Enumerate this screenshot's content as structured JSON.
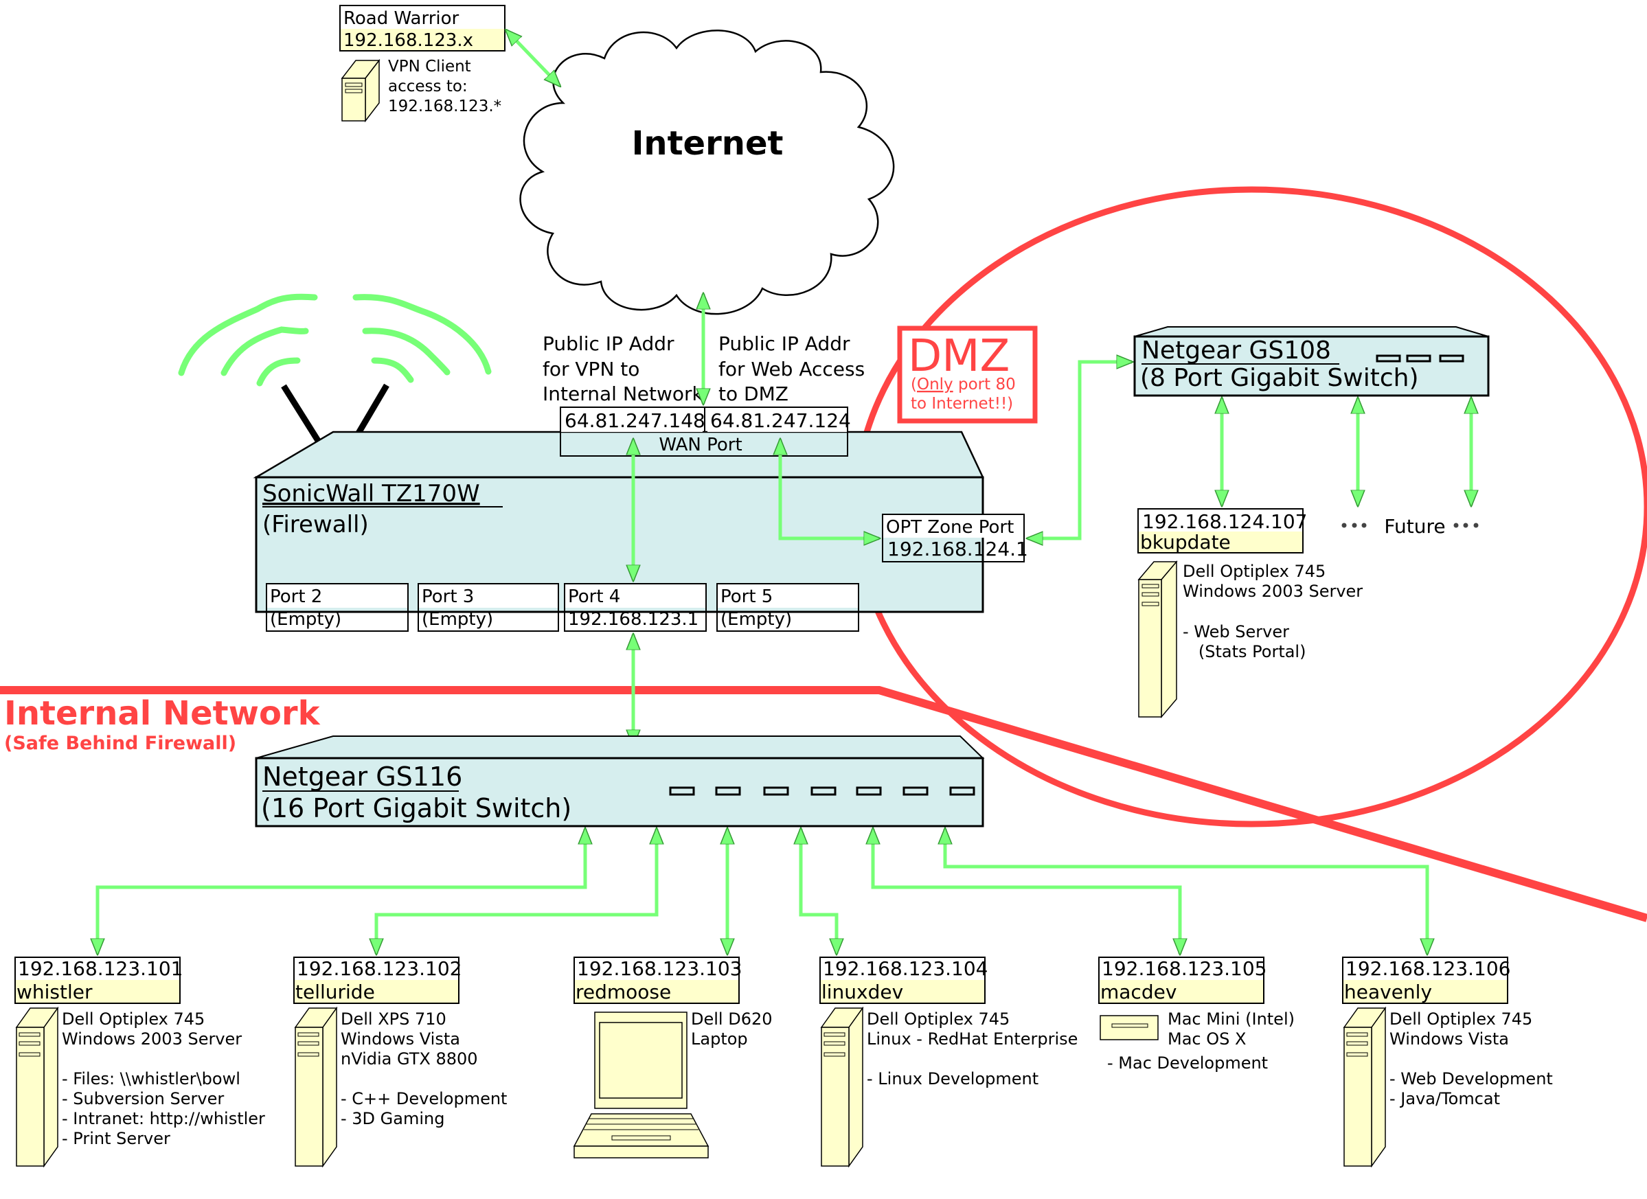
{
  "colors": {
    "device_fill": "#d6eeee",
    "label_yellow": "#ffffcc",
    "computer_fill": "#ffffcc",
    "link_green": "#77ff77",
    "zone_red": "#ff4444",
    "outline": "#000000"
  },
  "internet": {
    "label": "Internet"
  },
  "road_warrior": {
    "name": "Road Warrior",
    "ip": "192.168.123.x",
    "desc": [
      "VPN Client",
      "access to:",
      "192.168.123.*"
    ]
  },
  "wan": {
    "vpn_note": [
      "Public IP Addr",
      "for VPN to",
      "Internal Network"
    ],
    "dmz_note": [
      "Public IP Addr",
      "for Web Access",
      "to DMZ"
    ],
    "ip_vpn": "64.81.247.148",
    "ip_dmz": "64.81.247.124",
    "port_label": "WAN Port"
  },
  "firewall": {
    "name": "SonicWall TZ170W",
    "role": "(Firewall)",
    "ports": [
      {
        "name": "Port 2",
        "value": "(Empty)"
      },
      {
        "name": "Port 3",
        "value": "(Empty)"
      },
      {
        "name": "Port 4",
        "value": "192.168.123.1"
      },
      {
        "name": "Port 5",
        "value": "(Empty)"
      }
    ],
    "opt_port": {
      "name": "OPT Zone Port",
      "ip": "192.168.124.1"
    }
  },
  "dmz": {
    "title": "DMZ",
    "note_prefix": "(",
    "note_emph": "Only",
    "note_rest": " port 80",
    "note_line2": "to Internet!!)",
    "switch": {
      "name": "Netgear GS108",
      "desc": "(8 Port Gigabit Switch)"
    },
    "future_label": "Future",
    "host": {
      "ip": "192.168.124.107",
      "name": "bkupdate",
      "desc": [
        "Dell Optiplex 745",
        "Windows 2003 Server",
        "",
        "- Web Server",
        "   (Stats Portal)"
      ]
    }
  },
  "internal": {
    "title": "Internal Network",
    "subtitle": "(Safe Behind Firewall)",
    "switch": {
      "name": "Netgear GS116",
      "desc": "(16 Port Gigabit Switch)"
    },
    "hosts": [
      {
        "ip": "192.168.123.101",
        "name": "whistler",
        "type": "tower",
        "desc": [
          "Dell Optiplex 745",
          "Windows 2003 Server",
          "",
          "- Files: \\\\whistler\\bowl",
          "- Subversion Server",
          "- Intranet: http://whistler",
          "- Print Server"
        ]
      },
      {
        "ip": "192.168.123.102",
        "name": "telluride",
        "type": "tower",
        "desc": [
          "Dell XPS 710",
          "Windows Vista",
          "nVidia GTX 8800",
          "",
          "- C++ Development",
          "- 3D Gaming"
        ]
      },
      {
        "ip": "192.168.123.103",
        "name": "redmoose",
        "type": "laptop",
        "desc": [
          "Dell D620",
          "Laptop"
        ]
      },
      {
        "ip": "192.168.123.104",
        "name": "linuxdev",
        "type": "tower",
        "desc": [
          "Dell Optiplex 745",
          "Linux - RedHat Enterprise",
          "",
          "- Linux Development"
        ]
      },
      {
        "ip": "192.168.123.105",
        "name": "macdev",
        "type": "mini",
        "desc": [
          "Mac Mini (Intel)",
          "Mac OS X"
        ],
        "extra": "- Mac Development"
      },
      {
        "ip": "192.168.123.106",
        "name": "heavenly",
        "type": "tower",
        "desc": [
          "Dell Optiplex 745",
          "Windows Vista",
          "",
          "- Web Development",
          "- Java/Tomcat"
        ]
      }
    ]
  }
}
